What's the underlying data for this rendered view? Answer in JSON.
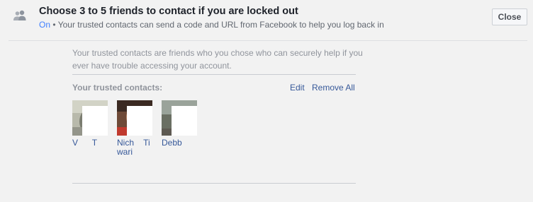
{
  "header": {
    "title": "Choose 3 to 5 friends to contact if you are locked out",
    "status": "On",
    "separator": "•",
    "description": "Your trusted contacts can send a code and URL from Facebook to help you log back in",
    "close_label": "Close",
    "icon": "people-icon"
  },
  "section": {
    "intro": "Your trusted contacts are friends who you chose who can securely help if you ever have trouble accessing your account.",
    "contacts_label": "Your trusted contacts:",
    "edit_label": "Edit",
    "remove_all_label": "Remove All"
  },
  "contacts": [
    {
      "name": "V      T"
    },
    {
      "name": "Nich    Tiwari"
    },
    {
      "name": "Debb"
    }
  ],
  "colors": {
    "link": "#365899",
    "status_on": "#4080ff",
    "background": "#f2f2f2"
  }
}
